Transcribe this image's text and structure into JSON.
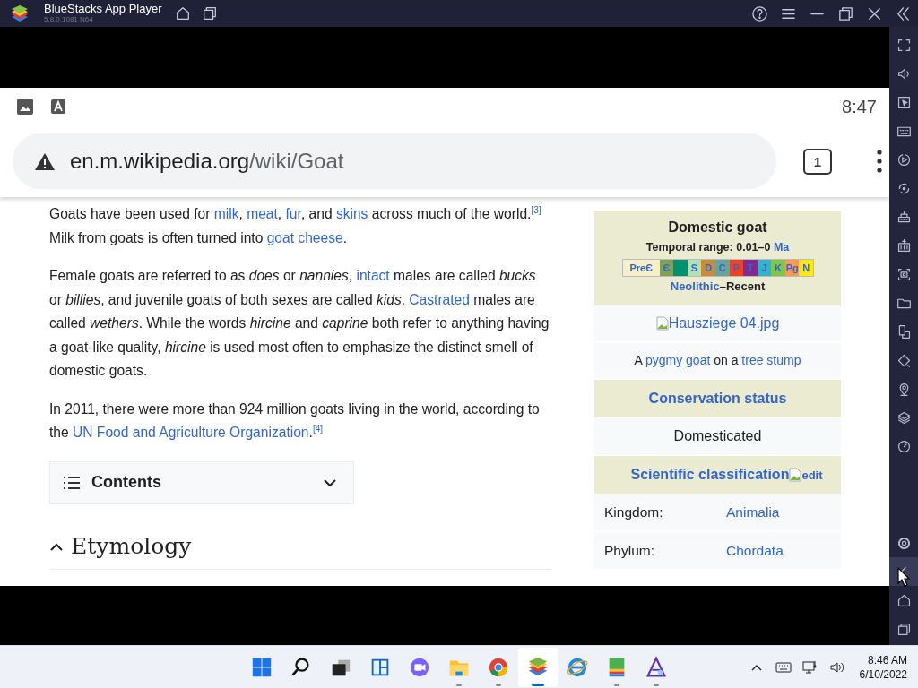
{
  "window": {
    "title": "BlueStacks App Player",
    "version": "5.8.0.1081 N64",
    "controls": [
      {
        "kind": "home"
      },
      {
        "kind": "tabs"
      }
    ],
    "buttons": [
      {
        "kind": "help"
      },
      {
        "kind": "menu"
      },
      {
        "kind": "minimize"
      },
      {
        "kind": "maximize"
      },
      {
        "kind": "close"
      },
      {
        "kind": "collapse"
      }
    ]
  },
  "sidebar": {
    "tools": [
      {
        "kind": "fullscreen"
      },
      {
        "kind": "volume"
      },
      {
        "kind": "pointer"
      },
      {
        "kind": "keyboard"
      },
      {
        "kind": "play"
      },
      {
        "kind": "sync"
      },
      {
        "kind": "machine"
      },
      {
        "kind": "package"
      },
      {
        "kind": "screenshot"
      },
      {
        "kind": "folder"
      },
      {
        "kind": "devices"
      },
      {
        "kind": "rotate"
      },
      {
        "kind": "location"
      },
      {
        "kind": "layers"
      },
      {
        "kind": "gauge"
      }
    ],
    "nav": [
      {
        "kind": "settings",
        "highlighted": false
      },
      {
        "kind": "back",
        "highlighted": true
      },
      {
        "kind": "home",
        "highlighted": false
      },
      {
        "kind": "recents",
        "highlighted": false
      }
    ]
  },
  "android_status": {
    "icons": [
      {
        "kind": "image"
      },
      {
        "kind": "font"
      }
    ],
    "time": "8:47"
  },
  "address_bar": {
    "domain": "en.m.wikipedia.org",
    "path": "/wiki/Goat",
    "tab_count": "1"
  },
  "article": {
    "paragraphs": [
      [
        {
          "kind": "text",
          "text": "Goats have been used for "
        },
        {
          "kind": "link",
          "text": "milk"
        },
        {
          "kind": "text",
          "text": ", "
        },
        {
          "kind": "link",
          "text": "meat"
        },
        {
          "kind": "text",
          "text": ", "
        },
        {
          "kind": "link",
          "text": "fur"
        },
        {
          "kind": "text",
          "text": ", and "
        },
        {
          "kind": "link",
          "text": "skins"
        },
        {
          "kind": "text",
          "text": " across much of the world."
        },
        {
          "kind": "ref",
          "text": "[3]"
        },
        {
          "kind": "text",
          "text": " Milk from goats is often turned into "
        },
        {
          "kind": "link",
          "text": "goat cheese"
        },
        {
          "kind": "text",
          "text": "."
        }
      ],
      [
        {
          "kind": "text",
          "text": "Female goats are referred to as "
        },
        {
          "kind": "italic",
          "text": "does"
        },
        {
          "kind": "text",
          "text": " or "
        },
        {
          "kind": "italic",
          "text": "nannies"
        },
        {
          "kind": "text",
          "text": ", "
        },
        {
          "kind": "link",
          "text": "intact"
        },
        {
          "kind": "text",
          "text": " males are called "
        },
        {
          "kind": "italic",
          "text": "bucks"
        },
        {
          "kind": "text",
          "text": " or "
        },
        {
          "kind": "italic",
          "text": "billies"
        },
        {
          "kind": "text",
          "text": ", and juvenile goats of both sexes are called "
        },
        {
          "kind": "italic",
          "text": "kids"
        },
        {
          "kind": "text",
          "text": ". "
        },
        {
          "kind": "link",
          "text": "Castrated"
        },
        {
          "kind": "text",
          "text": " males are called "
        },
        {
          "kind": "italic",
          "text": "wethers"
        },
        {
          "kind": "text",
          "text": ". While the words "
        },
        {
          "kind": "italic",
          "text": "hircine"
        },
        {
          "kind": "text",
          "text": " and "
        },
        {
          "kind": "italic",
          "text": "caprine"
        },
        {
          "kind": "text",
          "text": " both refer to anything having a goat-like quality, "
        },
        {
          "kind": "italic",
          "text": "hircine"
        },
        {
          "kind": "text",
          "text": " is used most often to emphasize the distinct smell of domestic goats."
        }
      ],
      [
        {
          "kind": "text",
          "text": "In 2011, there were more than 924 million goats living in the world, according to the "
        },
        {
          "kind": "link",
          "text": "UN Food and Agriculture Organization"
        },
        {
          "kind": "text",
          "text": "."
        },
        {
          "kind": "ref",
          "text": "[4]"
        }
      ]
    ],
    "contents": {
      "label": "Contents",
      "expanded": false
    },
    "section": {
      "title": "Etymology",
      "expanded": true
    }
  },
  "infobox": {
    "title": "Domestic goat",
    "temporal_range": "Temporal range: 0.01–0 ",
    "temporal_unit": "Ma",
    "timeline": [
      {
        "label": "PreЄ",
        "color": "#f7efc8"
      },
      {
        "label": "Є",
        "color": "#7fa056"
      },
      {
        "color": "#009270"
      },
      {
        "label": "S",
        "color": "#b3e1b6"
      },
      {
        "label": "D",
        "color": "#cb8c37"
      },
      {
        "label": "C",
        "color": "#67a599"
      },
      {
        "label": "P",
        "color": "#f04028"
      },
      {
        "label": "T",
        "color": "#812b92"
      },
      {
        "label": "J",
        "color": "#34b2c9"
      },
      {
        "label": "K",
        "color": "#7fc64e"
      },
      {
        "label": "Pg",
        "color": "#fd9a52"
      },
      {
        "label": "N",
        "color": "#ffe619"
      }
    ],
    "epoch_link": "Neolithic",
    "epoch_rest": "–Recent",
    "image_alt": "Hausziege 04.jpg",
    "caption": [
      {
        "kind": "text",
        "text": "A "
      },
      {
        "kind": "link",
        "text": "pygmy goat"
      },
      {
        "kind": "text",
        "text": " on a "
      },
      {
        "kind": "link",
        "text": "tree stump"
      }
    ],
    "conservation_header": "Conservation status",
    "conservation": "Domesticated",
    "classification_header": "Scientific classification",
    "edit_label": "edit",
    "ranks": [
      {
        "rank": "Kingdom:",
        "value": "Animalia"
      },
      {
        "rank": "Phylum:",
        "value": "Chordata"
      }
    ]
  },
  "taskbar": {
    "apps": [
      {
        "kind": "start",
        "running": false,
        "active": false
      },
      {
        "kind": "search",
        "running": false,
        "active": false
      },
      {
        "kind": "taskview",
        "running": false,
        "active": false
      },
      {
        "kind": "widgets",
        "running": false,
        "active": false
      },
      {
        "kind": "chat",
        "running": false,
        "active": false
      },
      {
        "kind": "explorer",
        "running": true,
        "active": false
      },
      {
        "kind": "chrome",
        "running": true,
        "active": false
      },
      {
        "kind": "bluestacks",
        "running": true,
        "active": true
      },
      {
        "kind": "ie",
        "running": false,
        "active": false
      },
      {
        "kind": "multi",
        "running": true,
        "active": false
      },
      {
        "kind": "triangle",
        "running": true,
        "active": false
      }
    ],
    "tray": [
      {
        "kind": "chevron"
      },
      {
        "kind": "keyboard"
      },
      {
        "kind": "network"
      },
      {
        "kind": "volume"
      }
    ],
    "time": "8:46 AM",
    "date": "6/10/2022"
  }
}
